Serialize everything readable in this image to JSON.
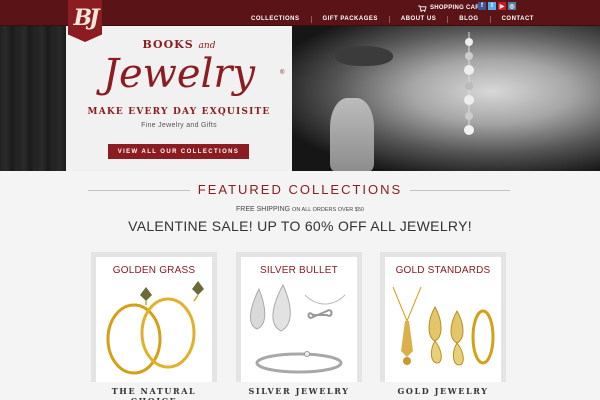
{
  "brand": {
    "logo_text": "BJ"
  },
  "header": {
    "cart_label": "SHOPPING CART",
    "social": [
      {
        "icon": "facebook-icon",
        "glyph": "f",
        "color": "#3b5998"
      },
      {
        "icon": "twitter-icon",
        "glyph": "t",
        "color": "#55acee"
      },
      {
        "icon": "youtube-icon",
        "glyph": "▶",
        "color": "#cc181e"
      },
      {
        "icon": "instagram-icon",
        "glyph": "◎",
        "color": "#517fa4"
      }
    ],
    "nav": [
      "COLLECTIONS",
      "GIFT PACKAGES",
      "ABOUT US",
      "BLOG",
      "CONTACT"
    ]
  },
  "hero": {
    "books": "BOOKS",
    "and": "and",
    "jewelry": "Jewelry",
    "registered": "®",
    "tagline": "MAKE EVERY DAY EXQUISITE",
    "subtagline": "Fine Jewelry and Gifts",
    "cta": "VIEW ALL OUR COLLECTIONS"
  },
  "featured": {
    "title": "FEATURED COLLECTIONS",
    "shipping_main": "FREE SHIPPING",
    "shipping_sub": "ON ALL ORDERS OVER $50",
    "sale": "VALENTINE SALE! UP TO 60% OFF ALL JEWELRY!"
  },
  "collections": [
    {
      "title": "GOLDEN GRASS",
      "caption": "THE NATURAL CHOICE"
    },
    {
      "title": "SILVER BULLET",
      "caption": "SILVER JEWELRY"
    },
    {
      "title": "GOLD STANDARDS",
      "caption": "GOLD JEWELRY"
    }
  ],
  "colors": {
    "brand": "#8b1c22",
    "topbar": "#5a1418",
    "gold": "#d4a017",
    "silver": "#c0c0c0"
  }
}
